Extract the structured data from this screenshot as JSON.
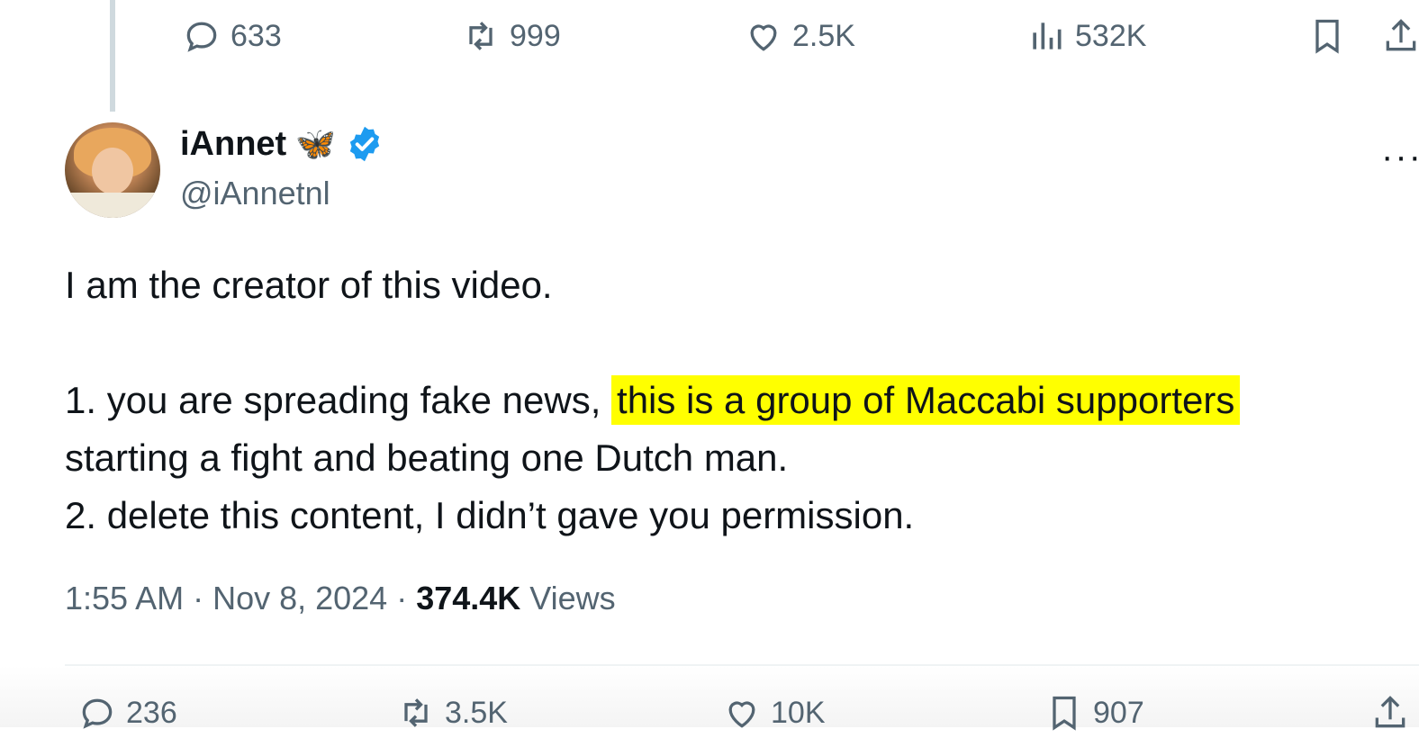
{
  "prev_tweet_actions": {
    "replies": "633",
    "reposts": "999",
    "likes": "2.5K",
    "views": "532K"
  },
  "tweet": {
    "display_name": "iAnnet",
    "name_emoji": "🦋",
    "handle": "@iAnnetnl",
    "more_label": "···",
    "line1": "I am the creator of this video.",
    "line2_before": "1. you are spreading fake news, ",
    "line2_highlight": "this is a group of Maccabi supporters",
    "line3": "starting a fight and beating one Dutch man.",
    "line4": "2. delete this content, I didn’t gave you permission.",
    "time": "1:55 AM · Nov 8, 2024 · ",
    "views_count": "374.4K",
    "views_label": " Views",
    "highlight_color": "#ffff00",
    "verified_color": "#1d9bf0"
  },
  "tweet_actions": {
    "replies": "236",
    "reposts": "3.5K",
    "likes": "10K",
    "bookmarks": "907"
  },
  "icons": {
    "reply": "reply-icon",
    "repost": "repost-icon",
    "like": "heart-icon",
    "views": "views-icon",
    "bookmark": "bookmark-icon",
    "share": "share-icon"
  }
}
